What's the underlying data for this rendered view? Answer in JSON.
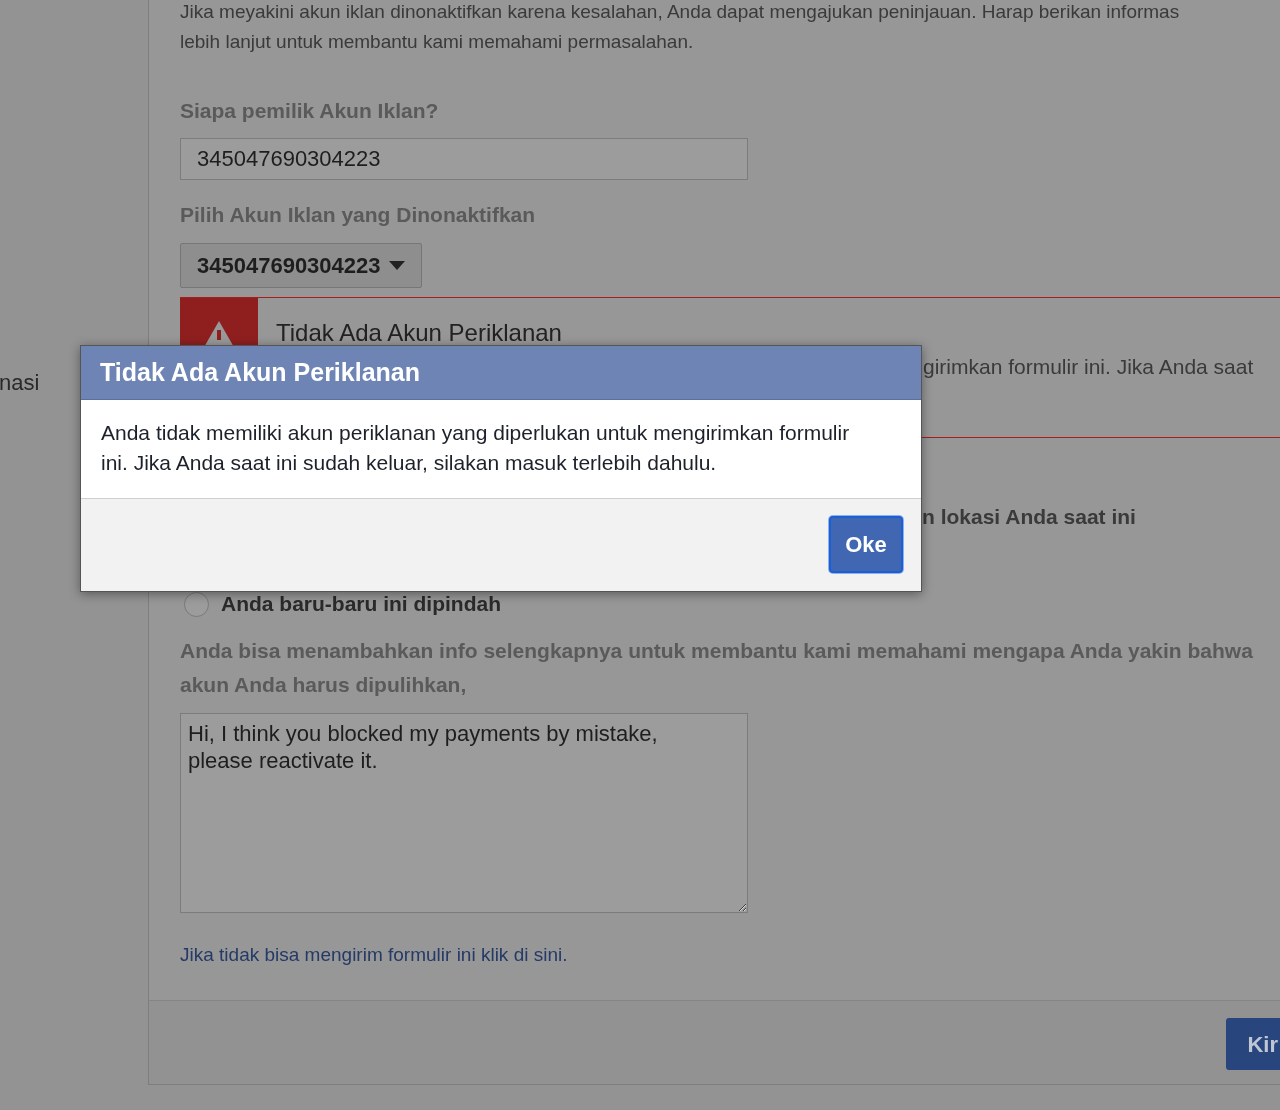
{
  "sidebar": {
    "label_fragment": "nasi"
  },
  "form": {
    "intro_lines": [
      "Jika meyakini akun iklan dinonaktifkan karena kesalahan, Anda dapat mengajukan peninjauan. Harap berikan informas",
      "lebih lanjut untuk membantu kami memahami permasalahan."
    ],
    "owner": {
      "label": "Siapa pemilik Akun Iklan?",
      "value": "345047690304223"
    },
    "account_select": {
      "label": "Pilih Akun Iklan yang Dinonaktifkan",
      "value": "345047690304223"
    },
    "alert": {
      "title": "Tidak Ada Akun Periklanan",
      "text_fragment": "girimkan formulir ini. Jika Anda saat"
    },
    "question_fragment": "n lokasi Anda saat ini",
    "radio_options": [
      {
        "label": "Anda baru-baru ini dipindah",
        "selected": false
      }
    ],
    "details": {
      "label": "Anda bisa menambahkan info selengkapnya untuk membantu kami memahami mengapa Anda yakin bahwa akun Anda harus dipulihkan,",
      "value": "Hi, I think you blocked my payments by mistake, please reactivate it."
    },
    "help_link": "Jika tidak bisa mengirim formulir ini klik di sini.",
    "submit_button": "Kir"
  },
  "dialog": {
    "title": "Tidak Ada Akun Periklanan",
    "message": "Anda tidak memiliki akun periklanan yang diperlukan untuk mengirimkan formulir ini. Jika Anda saat ini sudah keluar, silakan masuk terlebih dahulu.",
    "button": "Oke"
  }
}
